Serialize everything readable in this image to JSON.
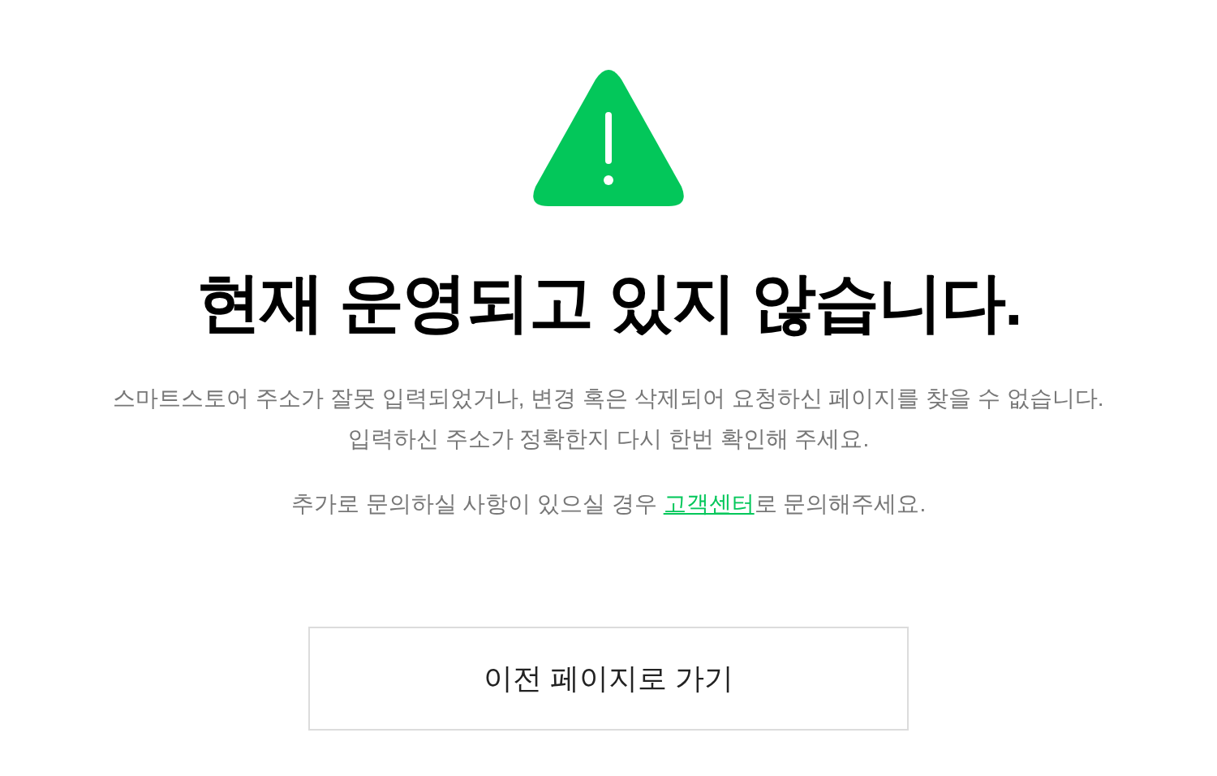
{
  "title": "현재 운영되고 있지 않습니다.",
  "description": [
    "스마트스토어 주소가 잘못 입력되었거나, 변경 혹은 삭제되어 요청하신 페이지를 찾을 수 없습니다.",
    "입력하신 주소가 정확한지 다시 한번 확인해 주세요."
  ],
  "contact": {
    "before": "추가로 문의하실 사항이 있으실 경우 ",
    "link": "고객센터",
    "after": "로 문의해주세요."
  },
  "button": "이전 페이지로 가기"
}
